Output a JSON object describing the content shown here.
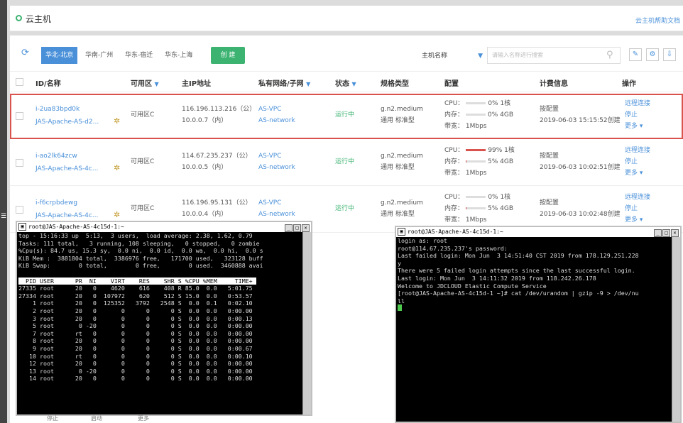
{
  "page": {
    "title": "云主机",
    "help_link": "云主机帮助文档"
  },
  "toolbar": {
    "regions": [
      "华北-北京",
      "华南-广州",
      "华东-宿迁",
      "华东-上海"
    ],
    "active_region": "华北-北京",
    "create_label": "创 建",
    "search_field": "主机名称",
    "search_placeholder": "请输入名称进行搜索"
  },
  "table": {
    "headers": [
      "ID/名称",
      "可用区",
      "主IP地址",
      "私有网络/子网",
      "状态",
      "规格类型",
      "配置",
      "计费信息",
      "操作"
    ],
    "rows": [
      {
        "id": "i-2ua83bpd0k",
        "name": "JAS-Apache-AS-d2...",
        "zone": "可用区C",
        "ip_public": "116.196.113.216（公）",
        "ip_private": "10.0.0.7（内）",
        "vpc": "AS-VPC",
        "subnet": "AS-network",
        "status": "运行中",
        "spec": "g.n2.medium",
        "spec_type": "通用 标准型",
        "cpu_label": "CPU：",
        "cpu": "0% 1核",
        "cpu_level": 0,
        "mem_label": "内存：",
        "mem": "0% 4GB",
        "mem_level": 0,
        "bandwidth": "带宽：  1Mbps",
        "billing": "按配置",
        "created": "2019-06-03 15:15:52创建",
        "actions": [
          "远程连接",
          "停止",
          "更多"
        ]
      },
      {
        "id": "i-ao2lk64zcw",
        "name": "JAS-Apache-AS-4c...",
        "zone": "可用区C",
        "ip_public": "114.67.235.237（公）",
        "ip_private": "10.0.0.5（内）",
        "vpc": "AS-VPC",
        "subnet": "AS-network",
        "status": "运行中",
        "spec": "g.n2.medium",
        "spec_type": "通用 标准型",
        "cpu_label": "CPU：",
        "cpu": "99% 1核",
        "cpu_level": 0.99,
        "mem_label": "内存：",
        "mem": "5% 4GB",
        "mem_level": 0.05,
        "bandwidth": "带宽：  1Mbps",
        "billing": "按配置",
        "created": "2019-06-03 10:02:51创建",
        "actions": [
          "远程连接",
          "停止",
          "更多"
        ]
      },
      {
        "id": "i-f6crpbdewg",
        "name": "JAS-Apache-AS-4c...",
        "zone": "可用区C",
        "ip_public": "116.196.95.131（公）",
        "ip_private": "10.0.0.4（内）",
        "vpc": "AS-VPC",
        "subnet": "AS-network",
        "status": "运行中",
        "spec": "g.n2.medium",
        "spec_type": "通用 标准型",
        "cpu_label": "CPU：",
        "cpu": "0% 1核",
        "cpu_level": 0,
        "mem_label": "内存：",
        "mem": "5% 4GB",
        "mem_level": 0.05,
        "bandwidth": "带宽：  1Mbps",
        "billing": "按配置",
        "created": "2019-06-03 10:02:48创建",
        "actions": [
          "远程连接",
          "停止",
          "更多"
        ]
      }
    ]
  },
  "terminal_top": {
    "title": "root@JAS-Apache-AS-4c15d-1:~",
    "lines": [
      "top - 15:16:33 up  5:13,  3 users,  load average: 2.38, 1.62, 0.79",
      "Tasks: 111 total,   3 running, 108 sleeping,   0 stopped,   0 zombie",
      "%Cpu(s): 84.7 us, 15.3 sy,  0.0 ni,  0.0 id,  0.0 wa,  0.0 hi,  0.0 s",
      "KiB Mem :  3881804 total,  3386976 free,   171700 used,   323128 buff",
      "KiB Swap:        0 total,        0 free,        0 used.  3460888 avai",
      ""
    ],
    "header": "  PID USER      PR  NI    VIRT    RES    SHR S %CPU %MEM     TIME+ ",
    "procs": [
      "27335 root      20   0    4620    616    408 R 85.0  0.0   5:01.75",
      "27334 root      20   0  107972    620    512 S 15.0  0.0   0:53.57",
      "    1 root      20   0  125352   3792   2548 S  0.0  0.1   0:02.10",
      "    2 root      20   0       0      0      0 S  0.0  0.0   0:00.00",
      "    3 root      20   0       0      0      0 S  0.0  0.0   0:00.13",
      "    5 root       0 -20       0      0      0 S  0.0  0.0   0:00.00",
      "    7 root      rt   0       0      0      0 S  0.0  0.0   0:00.00",
      "    8 root      20   0       0      0      0 S  0.0  0.0   0:00.00",
      "    9 root      20   0       0      0      0 S  0.0  0.0   0:00.67",
      "   10 root      rt   0       0      0      0 S  0.0  0.0   0:00.10",
      "   12 root      20   0       0      0      0 S  0.0  0.0   0:00.00",
      "   13 root       0 -20       0      0      0 S  0.0  0.0   0:00.00",
      "   14 root      20   0       0      0      0 S  0.0  0.0   0:00.00"
    ]
  },
  "terminal_right": {
    "title": "root@JAS-Apache-AS-4c15d-1:~",
    "lines": [
      "login as: root",
      "root@114.67.235.237's password:",
      "Last failed login: Mon Jun  3 14:51:40 CST 2019 from 178.129.251.228",
      "y",
      "There were 5 failed login attempts since the last successful login.",
      "Last login: Mon Jun  3 14:11:32 2019 from 118.242.26.178",
      "Welcome to JDCLOUD Elastic Compute Service",
      "[root@JAS-Apache-AS-4c15d-1 ~]# cat /dev/urandom | gzip -9 > /dev/nu",
      "ll"
    ]
  },
  "bottom": {
    "stop_label": "停止",
    "start_label": "启动",
    "more_label": "更多"
  },
  "colors": {
    "accent": "#4a90d9",
    "green": "#3cb371",
    "highlight": "#d9534f"
  }
}
